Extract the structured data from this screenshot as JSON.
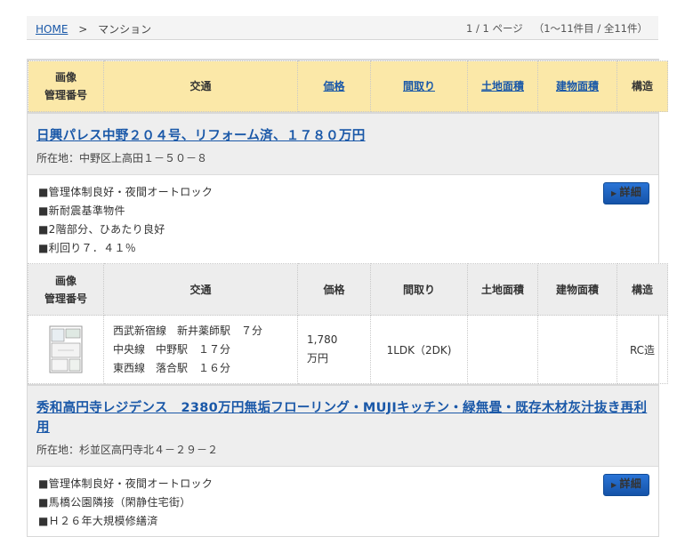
{
  "breadcrumb": {
    "home": "HOME",
    "sep": ">",
    "current": "マンション"
  },
  "pager": {
    "page": "1 / 1 ページ",
    "count": "（1～11件目 / 全11件）"
  },
  "columns": {
    "image": [
      "画像",
      "管理番号"
    ],
    "traffic": "交通",
    "price": "価格",
    "layout": "間取り",
    "land_area": "土地面積",
    "building_area": "建物面積",
    "structure": "構造"
  },
  "detail_label": "詳細",
  "properties": [
    {
      "title": "日興パレス中野２０４号、リフォーム済、１７８０万円",
      "address": "所在地：中野区上高田１－５０－８",
      "features": [
        "■管理体制良好・夜間オートロック",
        "■新耐震基準物件",
        "■2階部分、ひあたり良好",
        "■利回り７．４１％"
      ],
      "traffic": [
        "西武新宿線　新井薬師駅　７分",
        "中央線　中野駅　１７分",
        "東西線　落合駅　１６分"
      ],
      "price": [
        "1,780",
        "万円"
      ],
      "layout": "1LDK（2DK)",
      "land_area": "",
      "building_area": "",
      "structure": "RC造"
    },
    {
      "title": "秀和高円寺レジデンス　2380万円無垢フローリング・MUJIキッチン・緑無畳・既存木材灰汁抜き再利用",
      "address": "所在地：杉並区高円寺北４－２９－２",
      "features": [
        "■管理体制良好・夜間オートロック",
        "■馬橋公園隣接（閑静住宅街）",
        "■Ｈ２６年大規模修繕済"
      ]
    }
  ],
  "colors": {
    "header_bg": "#fbe8a8",
    "link": "#1a58a8",
    "button": "#1e5fba"
  }
}
